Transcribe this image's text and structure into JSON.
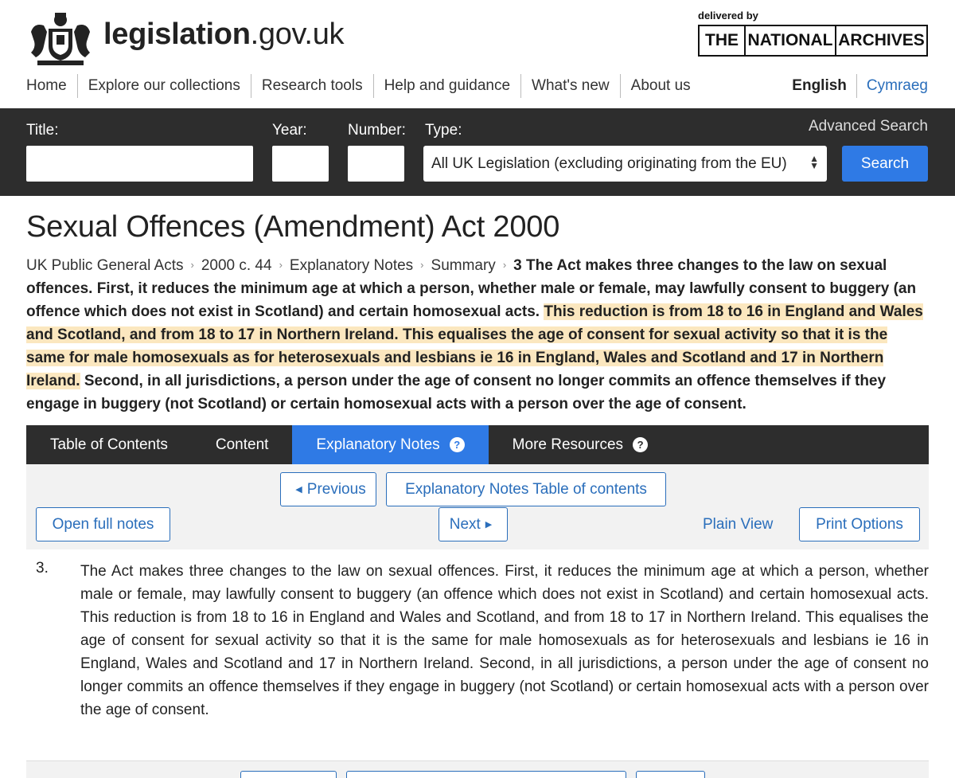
{
  "header": {
    "site_name_bold": "legislation",
    "site_name_rest": ".gov.uk",
    "delivered_by": "delivered by",
    "tna": [
      "THE",
      "NATIONAL",
      "ARCHIVES"
    ]
  },
  "nav": {
    "items": [
      "Home",
      "Explore our collections",
      "Research tools",
      "Help and guidance",
      "What's new",
      "About us"
    ],
    "lang_current": "English",
    "lang_other": "Cymraeg"
  },
  "search": {
    "title_label": "Title:",
    "year_label": "Year:",
    "number_label": "Number:",
    "type_label": "Type:",
    "type_value": "All UK Legislation (excluding originating from the EU)",
    "advanced": "Advanced Search",
    "button": "Search"
  },
  "page": {
    "title": "Sexual Offences (Amendment) Act 2000"
  },
  "breadcrumb": {
    "items": [
      "UK Public General Acts",
      "2000 c. 44",
      "Explanatory Notes",
      "Summary"
    ],
    "current_prefix": "3 The Act makes three changes to the law on sexual offences. First, it reduces the minimum age at which a person, whether male or female, may lawfully consent to buggery (an offence which does not exist in Scotland) and certain homosexual acts.",
    "highlighted": "This reduction is from 18 to 16 in England and Wales and Scotland, and from 18 to 17 in Northern Ireland. This equalises the age of consent for sexual activity so that it is the same for male homosexuals as for heterosexuals and lesbians ie 16 in England, Wales and Scotland and 17 in Northern Ireland.",
    "current_suffix": "Second, in all jurisdictions, a person under the age of consent no longer commits an offence themselves if they engage in buggery (not Scotland) or certain homosexual acts with a person over the age of consent."
  },
  "tabs": [
    {
      "label": "Table of Contents",
      "active": false,
      "help": false
    },
    {
      "label": "Content",
      "active": false,
      "help": false
    },
    {
      "label": "Explanatory Notes",
      "active": true,
      "help": true
    },
    {
      "label": "More Resources",
      "active": false,
      "help": true
    }
  ],
  "notes_nav": {
    "previous": "Previous",
    "toc": "Explanatory Notes Table of contents",
    "open_full": "Open full notes",
    "next": "Next",
    "plain_view": "Plain View",
    "print_options": "Print Options"
  },
  "content": {
    "number": "3.",
    "text": "The Act makes three changes to the law on sexual offences. First, it reduces the minimum age at which a person, whether male or female, may lawfully consent to buggery (an offence which does not exist in Scotland) and certain homosexual acts. This reduction is from 18 to 16 in England and Wales and Scotland, and from 18 to 17 in Northern Ireland. This equalises the age of consent for sexual activity so that it is the same for male homosexuals as for heterosexuals and lesbians ie 16 in England, Wales and Scotland and 17 in Northern Ireland. Second, in all jurisdictions, a person under the age of consent no longer commits an offence themselves if they engage in buggery (not Scotland) or certain homosexual acts with a person over the age of consent."
  },
  "colors": {
    "dark_bar": "#2d2d2d",
    "accent_blue": "#2f7ae5",
    "link_blue": "#2a6ebb",
    "highlight": "#fbe7bf"
  }
}
